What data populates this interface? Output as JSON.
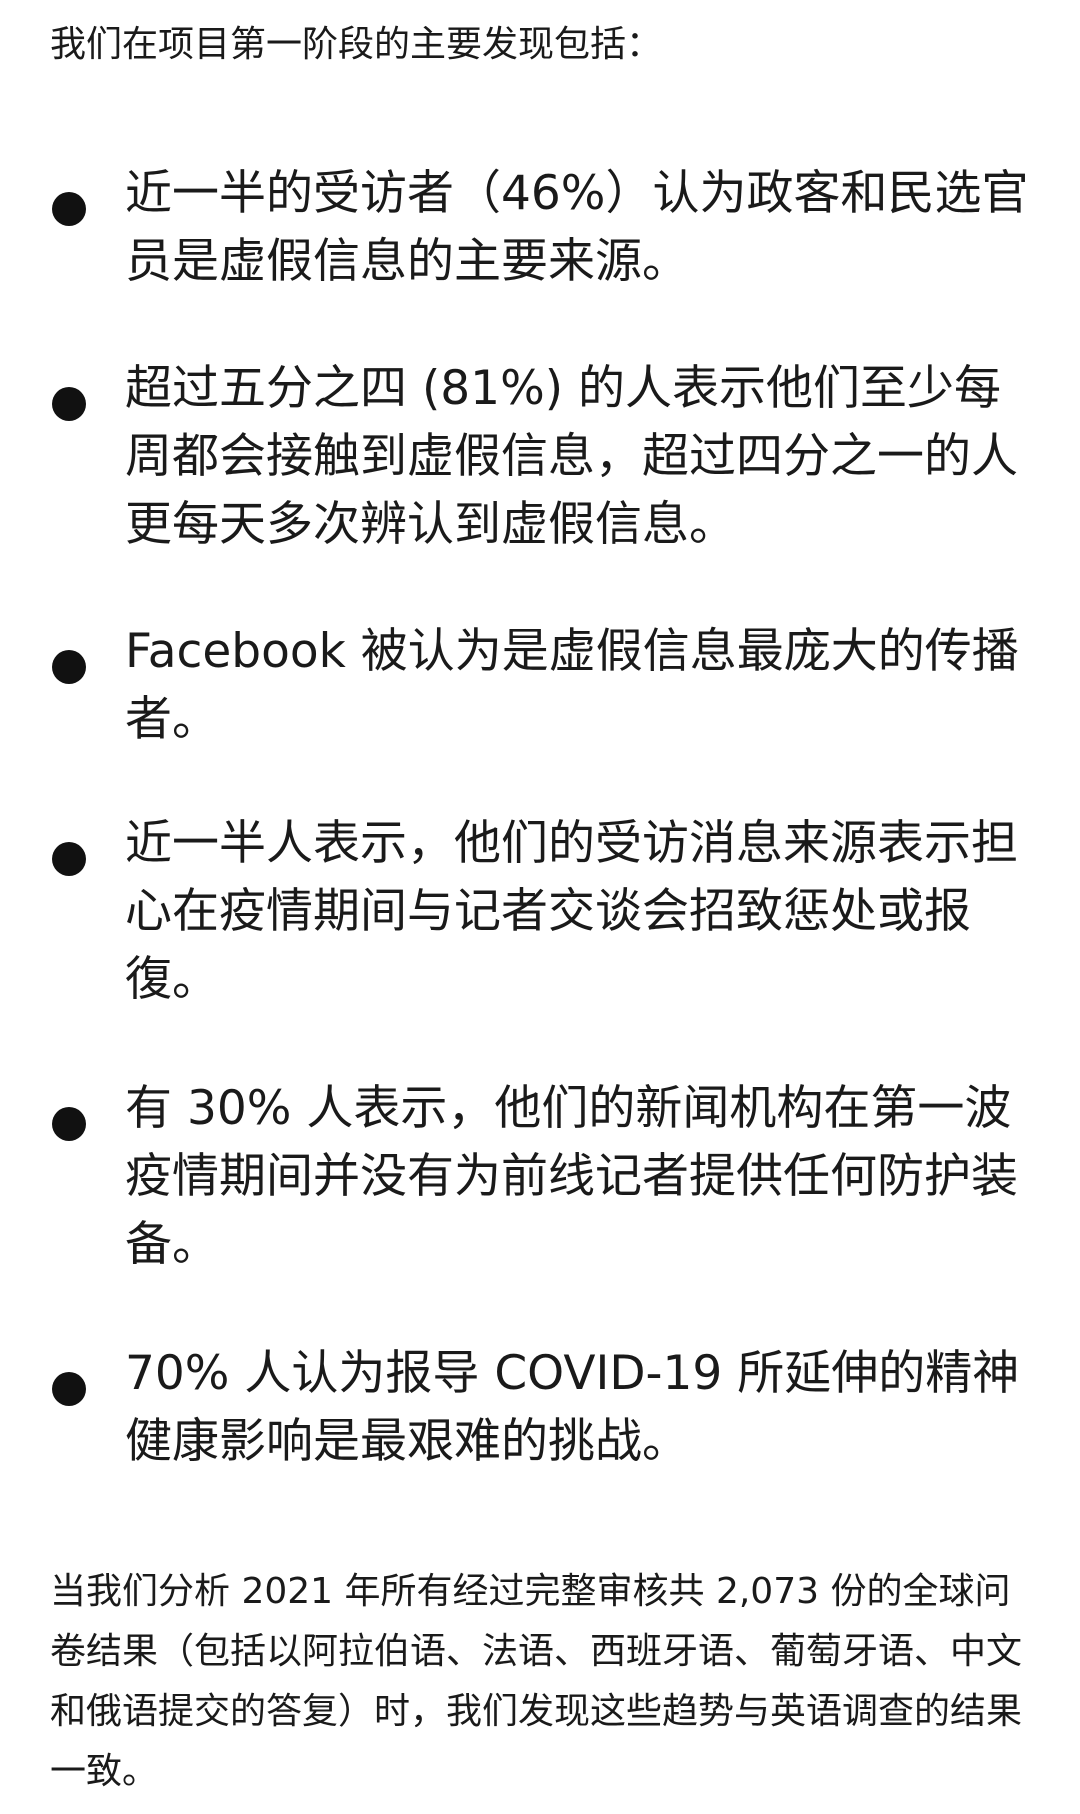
{
  "intro": "我们在项目第一阶段的主要发现包括：",
  "findings": [
    {
      "text": "近一半的受访者（46%）认为政客和民选官员是虚假信息的主要来源。"
    },
    {
      "text": "超过五分之四 (81%) 的人表示他们至少每周都会接触到虚假信息，超过四分之一的人更每天多次辨认到虚假信息。"
    },
    {
      "text": "Facebook 被认为是虚假信息最庞大的传播者。"
    },
    {
      "text": "近一半人表示，他们的受访消息来源表示担心在疫情期间与记者交谈会招致惩处或报復。"
    },
    {
      "text": "有 30% 人表示，他们的新闻机构在第一波疫情期间并没有为前线记者提供任何防护装备。"
    },
    {
      "text": "70% 人认为报导 COVID-19 所延伸的精神健康影响是最艰难的挑战。"
    }
  ],
  "conclusion": "当我们分析 2021 年所有经过完整审核共 2,073 份的全球问卷结果（包括以阿拉伯语、法语、西班牙语、葡萄牙语、中文和俄语提交的答复）时，我们发现这些趋势与英语调查的结果一致。"
}
